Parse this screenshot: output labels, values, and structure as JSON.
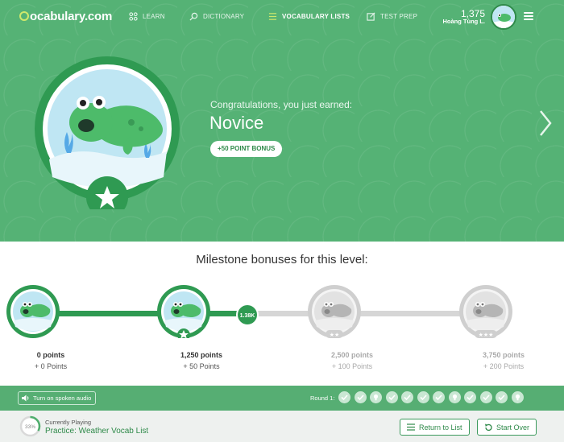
{
  "nav": {
    "logo": "ocabulary.com",
    "items": [
      {
        "label": "LEARN",
        "icon": "learn-icon"
      },
      {
        "label": "DICTIONARY",
        "icon": "search-icon"
      },
      {
        "label": "VOCABULARY LISTS",
        "icon": "list-icon",
        "active": true
      },
      {
        "label": "TEST PREP",
        "icon": "edit-icon"
      }
    ],
    "points": "1,375",
    "username": "Hoàng Tùng L."
  },
  "hero": {
    "earned_text": "Congratulations, you just earned:",
    "level_name": "Novice",
    "bonus_label": "+50 POINT BONUS"
  },
  "milestones": {
    "title": "Milestone bonuses for this level:",
    "current_marker": "1.38K",
    "items": [
      {
        "points": "0 points",
        "bonus": "+ 0 Points",
        "stars": 0,
        "unlocked": true
      },
      {
        "points": "1,250 points",
        "bonus": "+ 50 Points",
        "stars": 1,
        "unlocked": true
      },
      {
        "points": "2,500 points",
        "bonus": "+ 100 Points",
        "stars": 2,
        "unlocked": false
      },
      {
        "points": "3,750 points",
        "bonus": "+ 200 Points",
        "stars": 3,
        "unlocked": false
      }
    ]
  },
  "round": {
    "audio_label": "Turn on spoken audio",
    "label": "Round 1:",
    "dots": [
      "check",
      "check",
      "bulb",
      "check",
      "check",
      "check",
      "check",
      "bulb",
      "check",
      "check",
      "check",
      "bulb"
    ]
  },
  "footer": {
    "progress": "33%",
    "currently_playing": "Currently Playing",
    "title": "Practice: Weather Vocab List",
    "return_label": "Return to List",
    "start_over_label": "Start Over"
  },
  "colors": {
    "brand_green": "#55b275",
    "dark_green": "#2f8a4a"
  }
}
